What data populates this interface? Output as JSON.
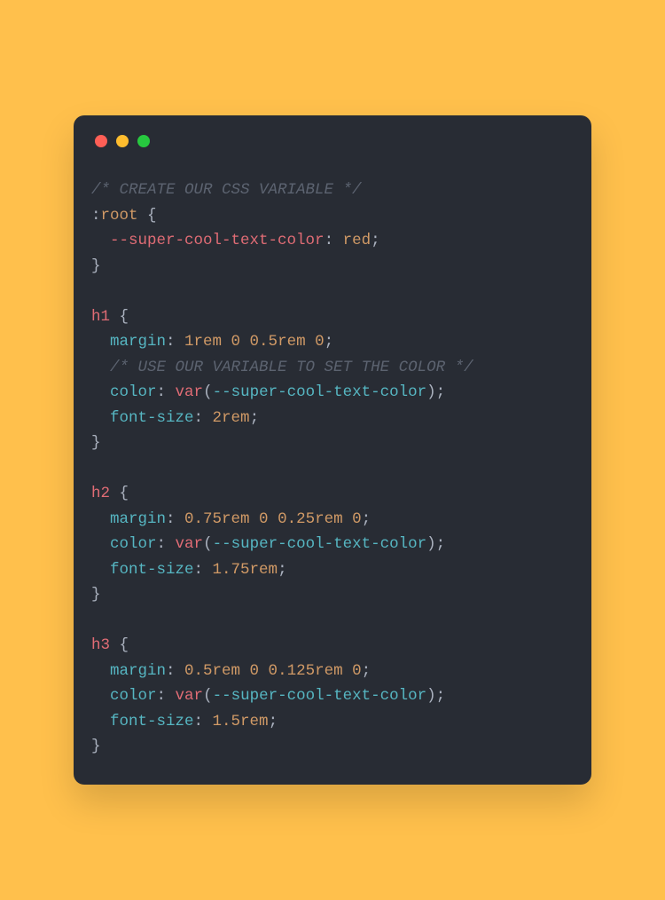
{
  "window": {
    "traffic_lights": [
      "red",
      "yellow",
      "green"
    ]
  },
  "code": {
    "lines": [
      {
        "tokens": [
          {
            "cls": "c-comment",
            "text": "/* CREATE OUR CSS VARIABLE */"
          }
        ]
      },
      {
        "tokens": [
          {
            "cls": "c-punct",
            "text": ":"
          },
          {
            "cls": "c-pseudo",
            "text": "root"
          },
          {
            "cls": "c-punct",
            "text": " {"
          }
        ]
      },
      {
        "tokens": [
          {
            "cls": "",
            "text": "  "
          },
          {
            "cls": "c-selector",
            "text": "--super-cool-text-color"
          },
          {
            "cls": "c-punct",
            "text": ": "
          },
          {
            "cls": "c-value",
            "text": "red"
          },
          {
            "cls": "c-punct",
            "text": ";"
          }
        ]
      },
      {
        "tokens": [
          {
            "cls": "c-punct",
            "text": "}"
          }
        ]
      },
      {
        "tokens": [
          {
            "cls": "",
            "text": ""
          }
        ]
      },
      {
        "tokens": [
          {
            "cls": "c-selector",
            "text": "h1"
          },
          {
            "cls": "c-punct",
            "text": " {"
          }
        ]
      },
      {
        "tokens": [
          {
            "cls": "",
            "text": "  "
          },
          {
            "cls": "c-prop",
            "text": "margin"
          },
          {
            "cls": "c-punct",
            "text": ": "
          },
          {
            "cls": "c-value",
            "text": "1rem 0 0.5rem 0"
          },
          {
            "cls": "c-punct",
            "text": ";"
          }
        ]
      },
      {
        "tokens": [
          {
            "cls": "",
            "text": "  "
          },
          {
            "cls": "c-comment",
            "text": "/* USE OUR VARIABLE TO SET THE COLOR */"
          }
        ]
      },
      {
        "tokens": [
          {
            "cls": "",
            "text": "  "
          },
          {
            "cls": "c-prop",
            "text": "color"
          },
          {
            "cls": "c-punct",
            "text": ": "
          },
          {
            "cls": "c-func",
            "text": "var"
          },
          {
            "cls": "c-punct",
            "text": "("
          },
          {
            "cls": "c-arg",
            "text": "--super-cool-text-color"
          },
          {
            "cls": "c-punct",
            "text": ");"
          }
        ]
      },
      {
        "tokens": [
          {
            "cls": "",
            "text": "  "
          },
          {
            "cls": "c-prop",
            "text": "font-size"
          },
          {
            "cls": "c-punct",
            "text": ": "
          },
          {
            "cls": "c-value",
            "text": "2rem"
          },
          {
            "cls": "c-punct",
            "text": ";"
          }
        ]
      },
      {
        "tokens": [
          {
            "cls": "c-punct",
            "text": "}"
          }
        ]
      },
      {
        "tokens": [
          {
            "cls": "",
            "text": ""
          }
        ]
      },
      {
        "tokens": [
          {
            "cls": "c-selector",
            "text": "h2"
          },
          {
            "cls": "c-punct",
            "text": " {"
          }
        ]
      },
      {
        "tokens": [
          {
            "cls": "",
            "text": "  "
          },
          {
            "cls": "c-prop",
            "text": "margin"
          },
          {
            "cls": "c-punct",
            "text": ": "
          },
          {
            "cls": "c-value",
            "text": "0.75rem 0 0.25rem 0"
          },
          {
            "cls": "c-punct",
            "text": ";"
          }
        ]
      },
      {
        "tokens": [
          {
            "cls": "",
            "text": "  "
          },
          {
            "cls": "c-prop",
            "text": "color"
          },
          {
            "cls": "c-punct",
            "text": ": "
          },
          {
            "cls": "c-func",
            "text": "var"
          },
          {
            "cls": "c-punct",
            "text": "("
          },
          {
            "cls": "c-arg",
            "text": "--super-cool-text-color"
          },
          {
            "cls": "c-punct",
            "text": ");"
          }
        ]
      },
      {
        "tokens": [
          {
            "cls": "",
            "text": "  "
          },
          {
            "cls": "c-prop",
            "text": "font-size"
          },
          {
            "cls": "c-punct",
            "text": ": "
          },
          {
            "cls": "c-value",
            "text": "1.75rem"
          },
          {
            "cls": "c-punct",
            "text": ";"
          }
        ]
      },
      {
        "tokens": [
          {
            "cls": "c-punct",
            "text": "}"
          }
        ]
      },
      {
        "tokens": [
          {
            "cls": "",
            "text": ""
          }
        ]
      },
      {
        "tokens": [
          {
            "cls": "c-selector",
            "text": "h3"
          },
          {
            "cls": "c-punct",
            "text": " {"
          }
        ]
      },
      {
        "tokens": [
          {
            "cls": "",
            "text": "  "
          },
          {
            "cls": "c-prop",
            "text": "margin"
          },
          {
            "cls": "c-punct",
            "text": ": "
          },
          {
            "cls": "c-value",
            "text": "0.5rem 0 0.125rem 0"
          },
          {
            "cls": "c-punct",
            "text": ";"
          }
        ]
      },
      {
        "tokens": [
          {
            "cls": "",
            "text": "  "
          },
          {
            "cls": "c-prop",
            "text": "color"
          },
          {
            "cls": "c-punct",
            "text": ": "
          },
          {
            "cls": "c-func",
            "text": "var"
          },
          {
            "cls": "c-punct",
            "text": "("
          },
          {
            "cls": "c-arg",
            "text": "--super-cool-text-color"
          },
          {
            "cls": "c-punct",
            "text": ");"
          }
        ]
      },
      {
        "tokens": [
          {
            "cls": "",
            "text": "  "
          },
          {
            "cls": "c-prop",
            "text": "font-size"
          },
          {
            "cls": "c-punct",
            "text": ": "
          },
          {
            "cls": "c-value",
            "text": "1.5rem"
          },
          {
            "cls": "c-punct",
            "text": ";"
          }
        ]
      },
      {
        "tokens": [
          {
            "cls": "c-punct",
            "text": "}"
          }
        ]
      }
    ]
  }
}
